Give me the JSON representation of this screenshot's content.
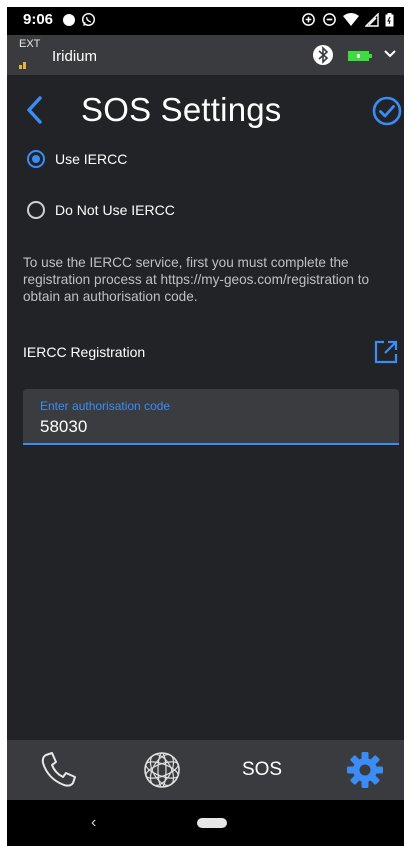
{
  "status_bar": {
    "time": "9:06",
    "icons": [
      "record-dot-icon",
      "whatsapp-icon",
      "data-saver-icon",
      "do-not-disturb-icon",
      "wifi-icon",
      "signal-icon",
      "battery-icon"
    ]
  },
  "device_bar": {
    "ext_label": "EXT",
    "network": "Iridium",
    "battery_color": "#3ddc3d"
  },
  "header": {
    "title": "SOS Settings",
    "accent": "#3b8cf4"
  },
  "options": [
    {
      "label": "Use IERCC",
      "checked": true
    },
    {
      "label": "Do Not Use IERCC",
      "checked": false
    }
  ],
  "info_text": "To use the IERCC service, first you must complete the registration process at https://my-geos.com/registration to obtain an authorisation code.",
  "registration": {
    "label": "IERCC Registration"
  },
  "auth_field": {
    "label": "Enter authorisation code",
    "value": "58030"
  },
  "bottom_nav": {
    "sos_label": "SOS",
    "active": "settings"
  },
  "system_nav": {
    "back_glyph": "‹"
  }
}
